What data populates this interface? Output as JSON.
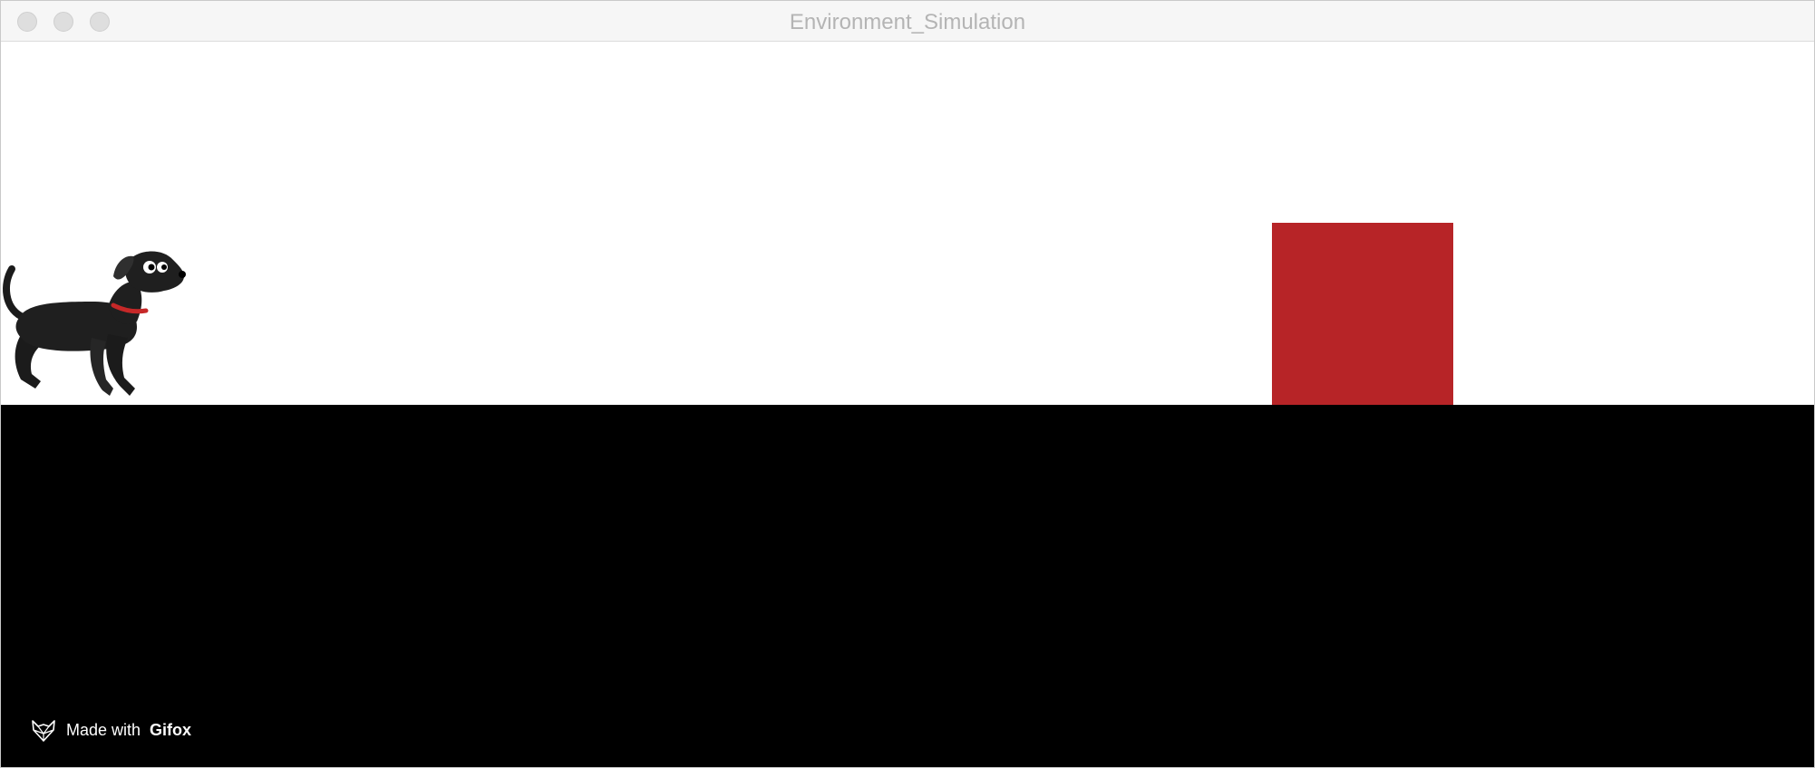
{
  "window": {
    "title": "Environment_Simulation"
  },
  "scene": {
    "agent_icon": "dog-icon",
    "obstacle_color": "#b72427",
    "ground_color": "#000000",
    "sky_color": "#ffffff"
  },
  "watermark": {
    "icon": "gifox-fox-icon",
    "prefix": "Made with",
    "brand": "Gifox"
  }
}
